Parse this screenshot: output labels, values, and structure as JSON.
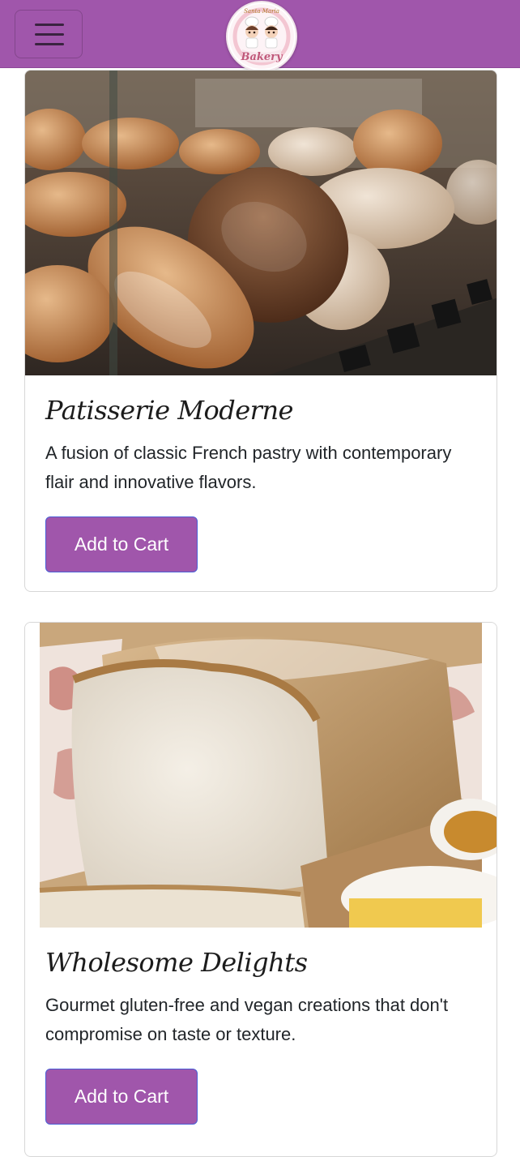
{
  "colors": {
    "brand": "#a056ab",
    "button": "#a056ab",
    "button_border": "#4a5fd6"
  },
  "navbar": {
    "menu_icon": "hamburger-menu-icon",
    "logo_text_top": "Santa Maria",
    "logo_text_bottom": "Bakery"
  },
  "products": [
    {
      "image": "artisan-bread-display-image",
      "title": "Patisserie Moderne",
      "description": "A fusion of classic French pastry with contemporary flair and innovative flavors.",
      "button_label": "Add to Cart"
    },
    {
      "image": "white-bread-loaf-image",
      "title": "Wholesome Delights",
      "description": "Gourmet gluten-free and vegan creations that don't compromise on taste or texture.",
      "button_label": "Add to Cart"
    }
  ]
}
